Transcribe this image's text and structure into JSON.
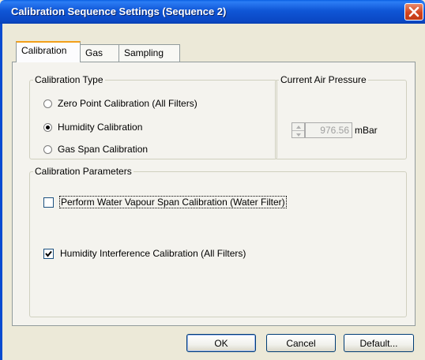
{
  "window": {
    "title": "Calibration Sequence Settings (Sequence 2)"
  },
  "tabs": [
    {
      "label": "Calibration",
      "active": true
    },
    {
      "label": "Gas",
      "active": false
    },
    {
      "label": "Sampling",
      "active": false
    }
  ],
  "calibration_type": {
    "legend": "Calibration Type",
    "options": [
      {
        "label": "Zero Point Calibration (All Filters)",
        "selected": false
      },
      {
        "label": "Humidity Calibration",
        "selected": true
      },
      {
        "label": "Gas Span Calibration",
        "selected": false
      }
    ]
  },
  "air_pressure": {
    "legend": "Current Air Pressure",
    "value": "976.56",
    "unit": "mBar",
    "enabled": false
  },
  "parameters": {
    "legend": "Calibration Parameters",
    "water_vapour": {
      "label": "Perform Water Vapour Span Calibration (Water Filter)",
      "checked": false
    },
    "humidity_interference": {
      "label": "Humidity Interference Calibration (All Filters)",
      "checked": true
    }
  },
  "buttons": {
    "ok": "OK",
    "cancel": "Cancel",
    "default": "Default..."
  },
  "icons": {
    "close": "close-icon",
    "check": "checkmark-icon",
    "spinner": "spinner-arrows-icon"
  },
  "colors": {
    "titlebar": "#0a47c4",
    "close_button": "#d3451f",
    "dialog_bg": "#ece9d8",
    "active_tab_accent": "#f2a01b"
  }
}
